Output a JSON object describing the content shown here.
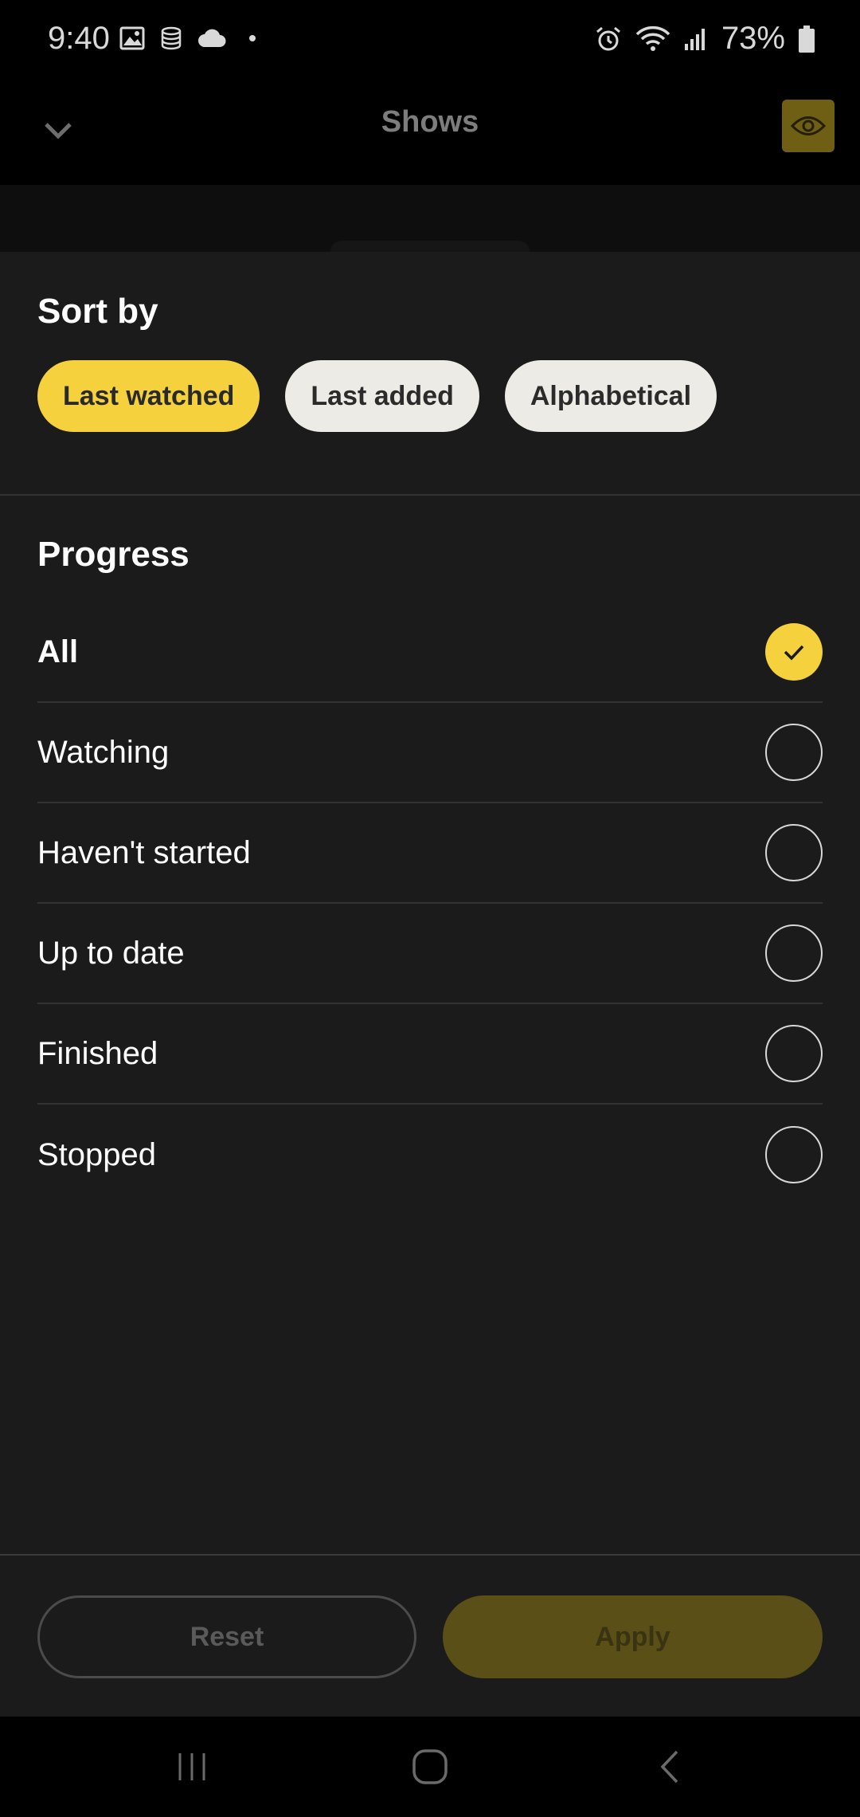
{
  "status_bar": {
    "time": "9:40",
    "battery_percent": "73%",
    "left_icons": [
      "image-icon",
      "storage-icon",
      "cloud-icon",
      "dot-icon"
    ],
    "right_icons": [
      "alarm-icon",
      "wifi-icon",
      "signal-icon",
      "battery-icon"
    ]
  },
  "header": {
    "title": "Shows",
    "back_icon": "chevron-down-icon",
    "action_icon": "eye-icon"
  },
  "sort": {
    "title": "Sort by",
    "options": [
      {
        "label": "Last watched",
        "selected": true
      },
      {
        "label": "Last added",
        "selected": false
      },
      {
        "label": "Alphabetical",
        "selected": false
      }
    ]
  },
  "progress": {
    "title": "Progress",
    "options": [
      {
        "label": "All",
        "selected": true
      },
      {
        "label": "Watching",
        "selected": false
      },
      {
        "label": "Haven't started",
        "selected": false
      },
      {
        "label": "Up to date",
        "selected": false
      },
      {
        "label": "Finished",
        "selected": false
      },
      {
        "label": "Stopped",
        "selected": false
      }
    ]
  },
  "footer": {
    "reset_label": "Reset",
    "apply_label": "Apply"
  },
  "nav": {
    "icons": [
      "recent-apps-icon",
      "home-icon",
      "back-icon"
    ]
  },
  "colors": {
    "accent": "#f4d13d",
    "sheet_bg": "#1b1b1b"
  }
}
